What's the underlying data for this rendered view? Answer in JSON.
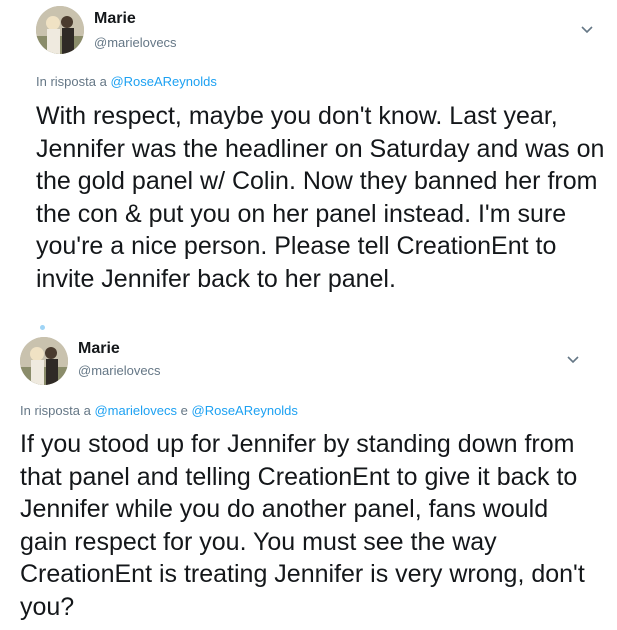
{
  "tweets": [
    {
      "author_name": "Marie",
      "author_handle": "@marielovecs",
      "reply_prefix": "In risposta a",
      "reply_to_1": "@RoseAReynolds",
      "reply_joiner": "",
      "reply_to_2": "",
      "text": "With respect, maybe you don't know. Last year, Jennifer was the headliner on Saturday and was on the gold panel w/ Colin. Now they banned her from the con & put you on her panel instead. I'm sure you're a nice person. Please tell CreationEnt to invite Jennifer back to her panel."
    },
    {
      "author_name": "Marie",
      "author_handle": "@marielovecs",
      "reply_prefix": "In risposta a",
      "reply_to_1": "@marielovecs",
      "reply_joiner": "e",
      "reply_to_2": "@RoseAReynolds",
      "text": "If you stood up for Jennifer by standing down from that panel and telling CreationEnt to give it back to Jennifer while you do another panel, fans would gain respect for you. You must see the way CreationEnt is treating Jennifer is very wrong, don't you?"
    }
  ],
  "icons": {
    "chevron": "chevron-down-icon",
    "avatar": "avatar"
  },
  "colors": {
    "text": "#14171a",
    "secondary": "#657786",
    "link": "#1da1f2"
  }
}
